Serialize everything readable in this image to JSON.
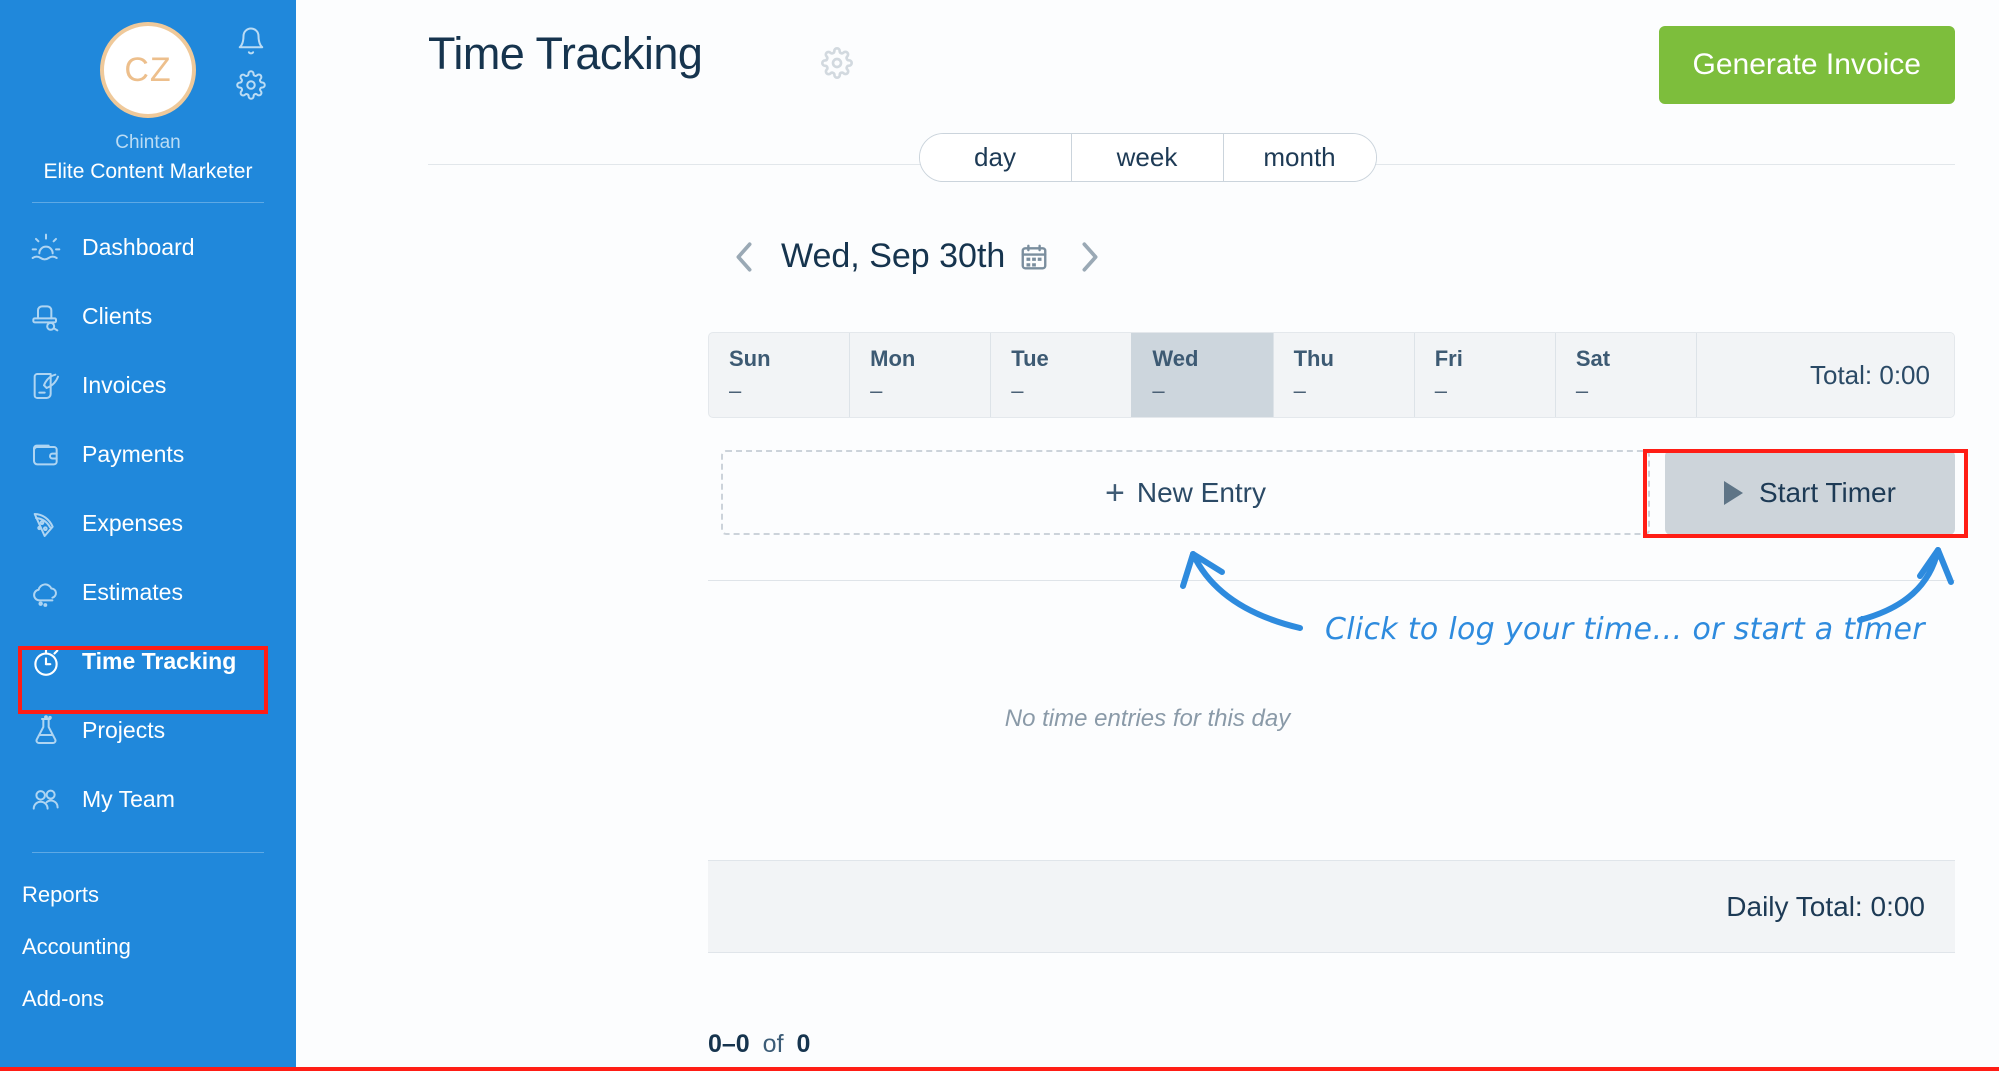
{
  "sidebar": {
    "avatar_initials": "CZ",
    "user_name": "Chintan",
    "user_role": "Elite Content Marketer",
    "icons": [
      {
        "name": "notifications-bell-icon",
        "label": "Notifications"
      },
      {
        "name": "settings-gear-icon",
        "label": "Settings"
      }
    ],
    "items": [
      {
        "label": "Dashboard",
        "icon": "sunrise-icon",
        "active": false
      },
      {
        "label": "Clients",
        "icon": "bowler-hat-icon",
        "active": false
      },
      {
        "label": "Invoices",
        "icon": "quill-scroll-icon",
        "active": false
      },
      {
        "label": "Payments",
        "icon": "wallet-icon",
        "active": false
      },
      {
        "label": "Expenses",
        "icon": "pizza-slice-icon",
        "active": false
      },
      {
        "label": "Estimates",
        "icon": "cloud-icon",
        "active": false
      },
      {
        "label": "Time Tracking",
        "icon": "stopwatch-icon",
        "active": true
      },
      {
        "label": "Projects",
        "icon": "flask-icon",
        "active": false
      },
      {
        "label": "My Team",
        "icon": "people-icon",
        "active": false
      }
    ],
    "sublinks": [
      {
        "label": "Reports"
      },
      {
        "label": "Accounting"
      },
      {
        "label": "Add-ons"
      }
    ]
  },
  "header": {
    "title": "Time Tracking",
    "settings_icon": "gear-icon",
    "generate_invoice_label": "Generate Invoice",
    "generate_invoice_color": "#7DBE3C"
  },
  "view_tabs": {
    "options": [
      "day",
      "week",
      "month"
    ],
    "selected": "day"
  },
  "date_nav": {
    "prev_label": "‹",
    "next_label": "›",
    "current_date": "Wed, Sep 30th",
    "calendar_icon": "calendar-icon"
  },
  "week_strip": {
    "days": [
      {
        "name": "Sun",
        "value": "–",
        "selected": false
      },
      {
        "name": "Mon",
        "value": "–",
        "selected": false
      },
      {
        "name": "Tue",
        "value": "–",
        "selected": false
      },
      {
        "name": "Wed",
        "value": "–",
        "selected": true
      },
      {
        "name": "Thu",
        "value": "–",
        "selected": false
      },
      {
        "name": "Fri",
        "value": "–",
        "selected": false
      },
      {
        "name": "Sat",
        "value": "–",
        "selected": false
      }
    ],
    "total_label": "Total: 0:00"
  },
  "entry_row": {
    "new_entry_label": "New Entry",
    "new_entry_plus": "+",
    "start_timer_label": "Start Timer"
  },
  "empty_state": {
    "message": "No time entries for this day"
  },
  "footer": {
    "daily_total_label": "Daily Total: 0:00",
    "pagination_range": "0–0",
    "pagination_of": "of",
    "pagination_total": "0"
  },
  "annotations": {
    "callout_text": "Click to log your time… or start a timer",
    "callout_color": "#2E8BDE",
    "highlight_color": "#FF1D15",
    "highlighted_targets": [
      "Time Tracking",
      "Start Timer"
    ]
  }
}
